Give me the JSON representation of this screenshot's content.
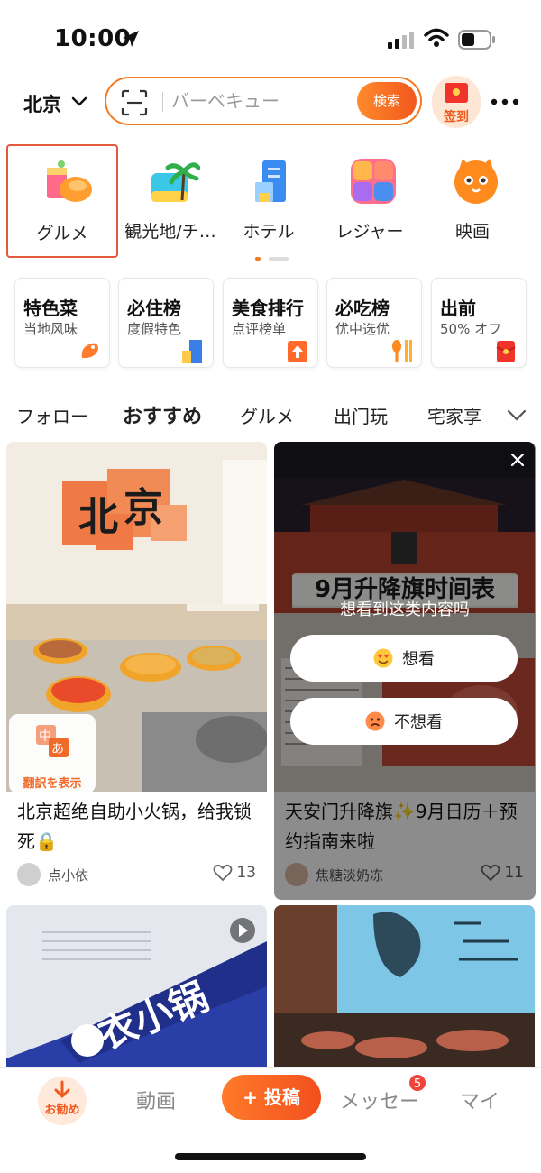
{
  "status_bar": {
    "time": "10:00"
  },
  "header": {
    "city": "北京",
    "search_placeholder": "バーベキュー",
    "search_button": "検索",
    "signin_label": "签到"
  },
  "categories": [
    {
      "label": "グルメ",
      "icon": "food-icon",
      "selected": true
    },
    {
      "label": "観光地/チ…",
      "icon": "palm-tree-icon",
      "selected": false
    },
    {
      "label": "ホテル",
      "icon": "hotel-icon",
      "selected": false
    },
    {
      "label": "レジャー",
      "icon": "leisure-icon",
      "selected": false
    },
    {
      "label": "映画",
      "icon": "cat-movie-icon",
      "selected": false
    }
  ],
  "quick_cards": [
    {
      "title": "特色菜",
      "subtitle": "当地风味",
      "icon": "shrimp-icon"
    },
    {
      "title": "必住榜",
      "subtitle": "度假特色",
      "icon": "building-icon"
    },
    {
      "title": "美食排行",
      "subtitle": "点评榜单",
      "icon": "rank-up-icon"
    },
    {
      "title": "必吃榜",
      "subtitle": "优中选优",
      "icon": "cutlery-icon"
    },
    {
      "title": "出前",
      "subtitle": "50% オフ",
      "icon": "red-envelope-icon"
    }
  ],
  "feed_tabs": [
    {
      "label": "フォロー",
      "active": false
    },
    {
      "label": "おすすめ",
      "active": true
    },
    {
      "label": "グルメ",
      "active": false
    },
    {
      "label": "出门玩",
      "active": false
    },
    {
      "label": "宅家享",
      "active": false
    }
  ],
  "feed": {
    "post1": {
      "title": "北京超绝自助小火锅，给我锁死🔒",
      "author": "点小依",
      "likes": "13",
      "translate_label": "翻訳を表示"
    },
    "post2": {
      "title": "天安门升降旗✨9月日历＋预约指南来啦",
      "author": "焦糖淡奶冻",
      "likes": "11",
      "image_caption": "9月升降旗时间表",
      "overlay_prompt": "想看到这类内容吗",
      "want_label": "想看",
      "not_want_label": "不想看"
    }
  },
  "bottom_nav": {
    "home_label": "お勧め",
    "video_label": "動画",
    "post_label": "投稿",
    "messages_label": "メッセー",
    "messages_badge": "5",
    "mine_label": "マイ"
  },
  "colors": {
    "accent": "#f47a22",
    "accent_dark": "#f2571d",
    "selected_border": "#e3593f"
  }
}
